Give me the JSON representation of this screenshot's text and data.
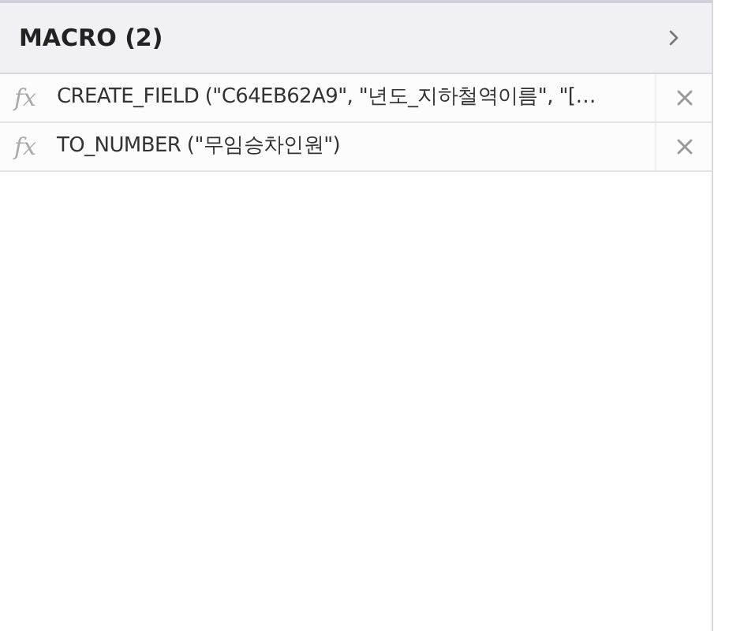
{
  "panel": {
    "title": "MACRO (2)"
  },
  "items": [
    {
      "icon": "fx",
      "text": "CREATE_FIELD (\"C64EB62A9\", \"년도_지하철역이름\", \"[…"
    },
    {
      "icon": "fx",
      "text": "TO_NUMBER (\"무임승차인원\")"
    }
  ]
}
